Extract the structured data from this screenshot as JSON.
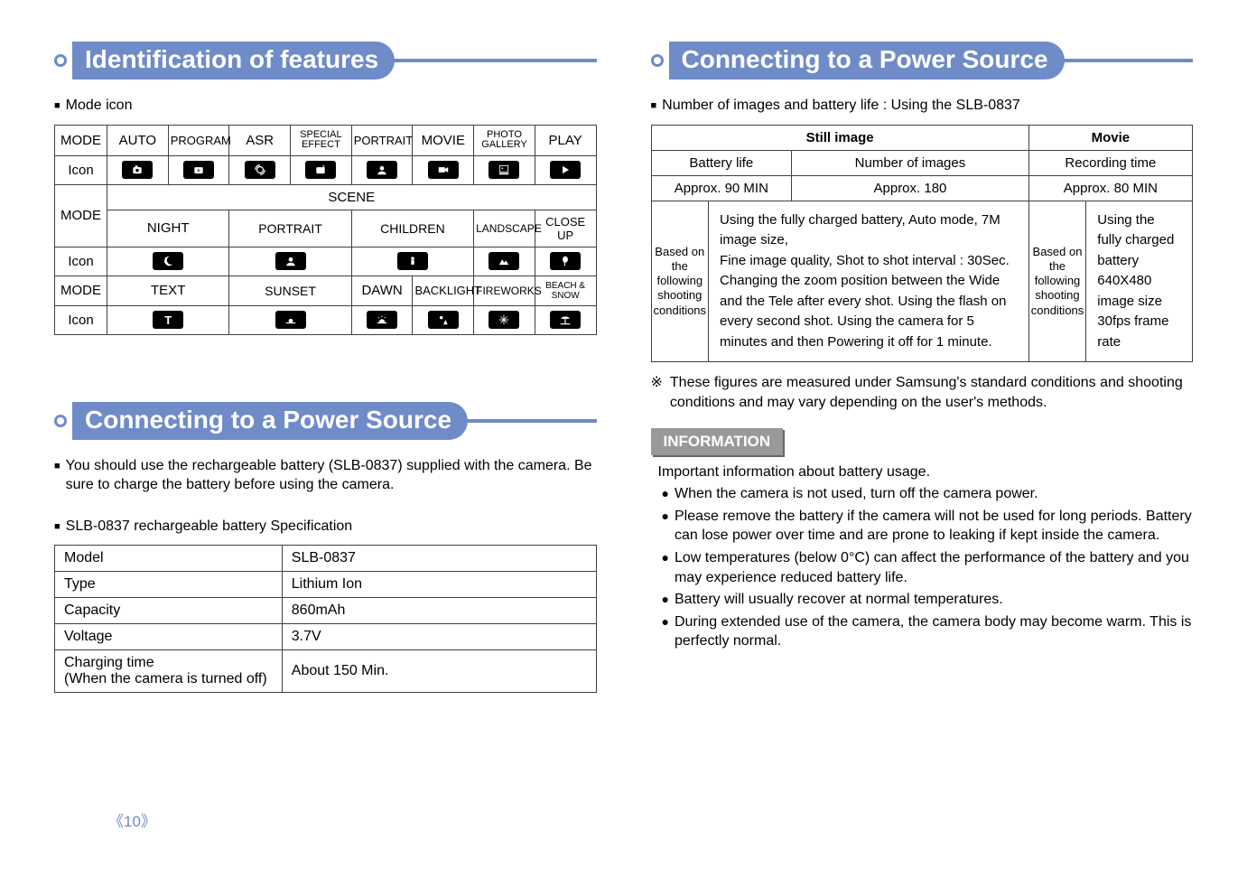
{
  "page_number": "《10》",
  "left": {
    "heading1": "Identification of features",
    "mode_icon_label": "Mode icon",
    "modes_row1": [
      "MODE",
      "AUTO",
      "PROGRAM",
      "ASR",
      "SPECIAL EFFECT",
      "PORTRAIT",
      "MOVIE",
      "PHOTO GALLERY",
      "PLAY"
    ],
    "modes_row1_icon": "Icon",
    "modes_row2_header": [
      "MODE"
    ],
    "scene_label": "SCENE",
    "modes_row2_cols": [
      "NIGHT",
      "PORTRAIT",
      "CHILDREN",
      "LANDSCAPE",
      "CLOSE UP"
    ],
    "modes_row2_icon": "Icon",
    "modes_row3": [
      "MODE",
      "TEXT",
      "SUNSET",
      "DAWN",
      "BACKLIGHT",
      "FIREWORKS",
      "BEACH & SNOW"
    ],
    "modes_row3_icon": "Icon",
    "heading2": "Connecting to a Power Source",
    "para1": "You should use the rechargeable battery (SLB-0837) supplied with the camera. Be sure to charge the battery before using the camera.",
    "spec_label": "SLB-0837 rechargeable battery Specification",
    "spec_rows": [
      [
        "Model",
        "SLB-0837"
      ],
      [
        "Type",
        "Lithium Ion"
      ],
      [
        "Capacity",
        "860mAh"
      ],
      [
        "Voltage",
        "3.7V"
      ],
      [
        "Charging time\n(When the camera is turned off)",
        "About 150 Min."
      ]
    ]
  },
  "right": {
    "heading": "Connecting to a Power Source",
    "batt_intro": "Number of images and battery life : Using the SLB-0837",
    "batt_head": [
      "Still image",
      "Movie"
    ],
    "batt_sub": [
      "Battery life",
      "Number of images",
      "Recording time"
    ],
    "batt_vals": [
      "Approx. 90 MIN",
      "Approx. 180",
      "Approx. 80 MIN"
    ],
    "cond_label": "Based on the following shooting conditions",
    "cond_still": "Using the fully charged battery, Auto mode, 7M image size,\nFine image quality, Shot to shot interval : 30Sec.\nChanging the zoom position between the Wide and the Tele after every shot. Using the flash on every second shot. Using the camera for 5 minutes and then Powering it off for 1 minute.",
    "cond_movie": "Using the fully charged battery\n640X480 image size\n30fps frame rate",
    "starnote": "These figures are measured under Samsung's standard conditions and shooting conditions and may vary depending on the user's methods.",
    "info_label": "INFORMATION",
    "info_intro": "Important information about battery usage.",
    "info_items": [
      "When the camera is not used, turn off the camera power.",
      "Please remove the battery if the camera will not be used for long periods. Battery can lose power over time and are prone to leaking if kept inside the camera.",
      "Low temperatures (below 0°C) can affect the performance of the battery and you may experience reduced battery life.",
      "Battery will usually recover at normal temperatures.",
      "During extended use of the camera, the camera body may become warm. This is perfectly normal."
    ]
  },
  "icons": {
    "auto": "auto",
    "program": "program",
    "asr": "asr",
    "special": "special",
    "portrait": "portrait",
    "movie": "movie",
    "gallery": "gallery",
    "play": "play",
    "night": "night",
    "portrait2": "portrait",
    "children": "children",
    "landscape": "landscape",
    "closeup": "closeup",
    "text": "text",
    "sunset": "sunset",
    "dawn": "dawn",
    "backlight": "backlight",
    "fireworks": "fireworks",
    "beach": "beach"
  }
}
